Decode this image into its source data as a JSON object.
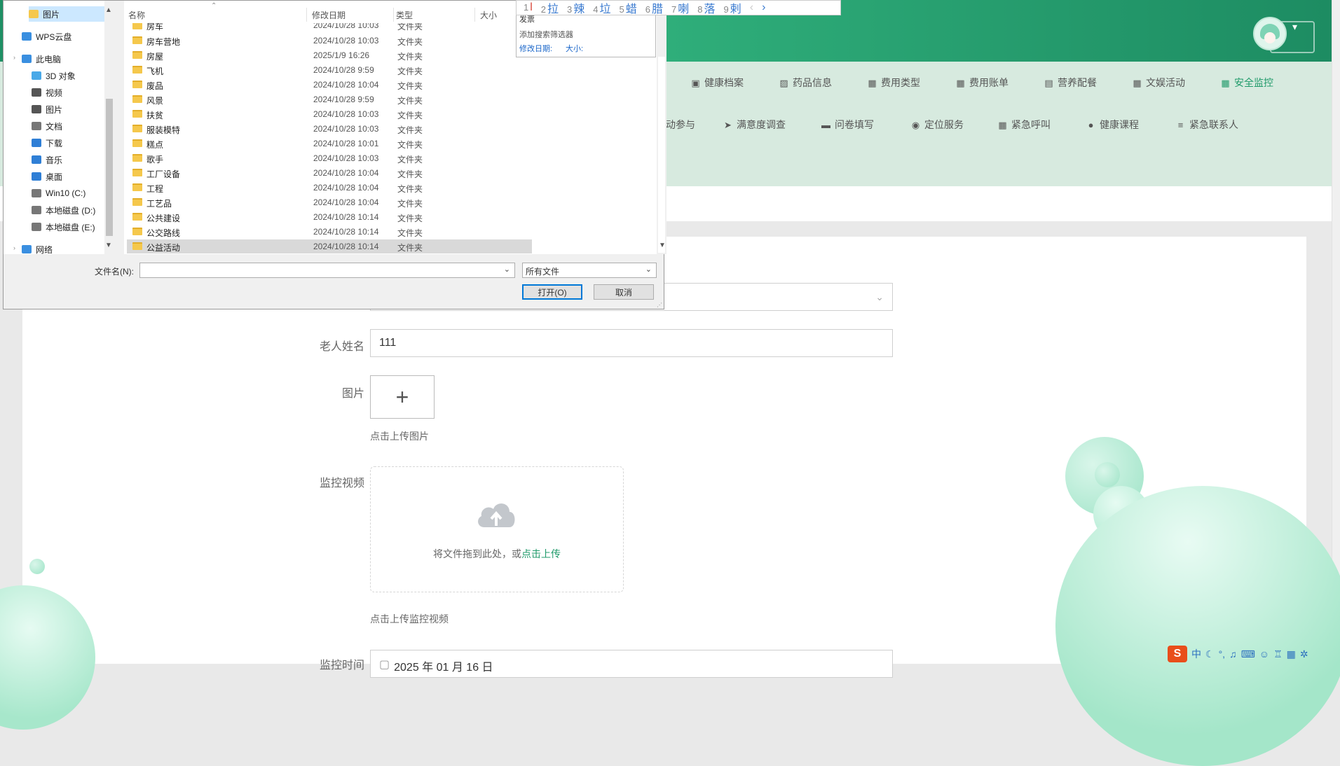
{
  "app": {
    "nav_row1": [
      {
        "icon": "briefcase-icon",
        "label": "健康档案"
      },
      {
        "icon": "chart-icon",
        "label": "药品信息"
      },
      {
        "icon": "grid-icon",
        "label": "费用类型"
      },
      {
        "icon": "grid-icon",
        "label": "费用账单"
      },
      {
        "icon": "clipboard-icon",
        "label": "营养配餐"
      },
      {
        "icon": "grid-icon",
        "label": "文娱活动"
      },
      {
        "icon": "grid-icon",
        "label": "安全监控"
      }
    ],
    "nav_row2": [
      {
        "icon": "",
        "label": "动参与"
      },
      {
        "icon": "send-icon",
        "label": "满意度调查"
      },
      {
        "icon": "monitor-icon",
        "label": "问卷填写"
      },
      {
        "icon": "user-icon",
        "label": "定位服务"
      },
      {
        "icon": "grid-icon",
        "label": "紧急呼叫"
      },
      {
        "icon": "pin-icon",
        "label": "健康课程"
      },
      {
        "icon": "menu-icon",
        "label": "紧急联系人"
      }
    ],
    "active_nav": "安全监控",
    "accent_color": "#1f9a6a"
  },
  "form": {
    "elder_name_label": "老人姓名",
    "elder_name_value": "111",
    "image_label": "图片",
    "image_upload_plus": "+",
    "image_hint": "点击上传图片",
    "video_label": "监控视频",
    "dropzone_text": "将文件拖到此处，或",
    "dropzone_link": "点击上传",
    "video_hint": "点击上传监控视频",
    "time_label": "监控时间",
    "time_value": "2025 年 01 月 16 日"
  },
  "file_dialog": {
    "nav_pane": [
      {
        "icon": "folder-icon",
        "label": "图片"
      },
      {
        "icon": "cloud-icon",
        "label": "WPS云盘"
      },
      {
        "icon": "computer-icon",
        "label": "此电脑"
      },
      {
        "icon": "cube-icon",
        "label": "3D 对象"
      },
      {
        "icon": "video-icon",
        "label": "视频"
      },
      {
        "icon": "image-icon",
        "label": "图片"
      },
      {
        "icon": "document-icon",
        "label": "文档"
      },
      {
        "icon": "download-icon",
        "label": "下载"
      },
      {
        "icon": "music-icon",
        "label": "音乐"
      },
      {
        "icon": "desktop-icon",
        "label": "桌面"
      },
      {
        "icon": "drive-icon",
        "label": "Win10 (C:)"
      },
      {
        "icon": "drive-icon",
        "label": "本地磁盘 (D:)"
      },
      {
        "icon": "drive-icon",
        "label": "本地磁盘 (E:)"
      },
      {
        "icon": "network-icon",
        "label": "网络"
      }
    ],
    "columns": {
      "name": "名称",
      "date": "修改日期",
      "type": "类型",
      "size": "大小"
    },
    "rows": [
      {
        "name": "房车",
        "date": "2024/10/28 10:03",
        "type": "文件夹"
      },
      {
        "name": "房车营地",
        "date": "2024/10/28 10:03",
        "type": "文件夹"
      },
      {
        "name": "房屋",
        "date": "2025/1/9 16:26",
        "type": "文件夹"
      },
      {
        "name": "飞机",
        "date": "2024/10/28 9:59",
        "type": "文件夹"
      },
      {
        "name": "废品",
        "date": "2024/10/28 10:04",
        "type": "文件夹"
      },
      {
        "name": "风景",
        "date": "2024/10/28 9:59",
        "type": "文件夹"
      },
      {
        "name": "扶贫",
        "date": "2024/10/28 10:03",
        "type": "文件夹"
      },
      {
        "name": "服装模特",
        "date": "2024/10/28 10:03",
        "type": "文件夹"
      },
      {
        "name": "糕点",
        "date": "2024/10/28 10:01",
        "type": "文件夹"
      },
      {
        "name": "歌手",
        "date": "2024/10/28 10:03",
        "type": "文件夹"
      },
      {
        "name": "工厂设备",
        "date": "2024/10/28 10:04",
        "type": "文件夹"
      },
      {
        "name": "工程",
        "date": "2024/10/28 10:04",
        "type": "文件夹"
      },
      {
        "name": "工艺品",
        "date": "2024/10/28 10:04",
        "type": "文件夹"
      },
      {
        "name": "公共建设",
        "date": "2024/10/28 10:14",
        "type": "文件夹"
      },
      {
        "name": "公交路线",
        "date": "2024/10/28 10:14",
        "type": "文件夹"
      },
      {
        "name": "公益活动",
        "date": "2024/10/28 10:14",
        "type": "文件夹"
      }
    ],
    "selected_row": "公益活动",
    "filename_label": "文件名(N):",
    "filename_value": "",
    "filetype_value": "所有文件",
    "open_button": "打开(O)",
    "cancel_button": "取消",
    "search_suggest": {
      "partial": "发票",
      "add_filter": "添加搜索筛选器",
      "filter_date": "修改日期:",
      "filter_size": "大小:"
    }
  },
  "ime": {
    "candidates": [
      {
        "num": "1",
        "text": "l"
      },
      {
        "num": "2",
        "text": "拉"
      },
      {
        "num": "3",
        "text": "辣"
      },
      {
        "num": "4",
        "text": "垃"
      },
      {
        "num": "5",
        "text": "蜡"
      },
      {
        "num": "6",
        "text": "腊"
      },
      {
        "num": "7",
        "text": "喇"
      },
      {
        "num": "8",
        "text": "落"
      },
      {
        "num": "9",
        "text": "剌"
      }
    ],
    "prev": "‹",
    "next": "›"
  },
  "tray": {
    "logo": "S",
    "mode": "中",
    "icons": [
      "moon-icon",
      "punctuation-icon",
      "mic-icon",
      "keyboard-icon",
      "user-icon",
      "shirt-icon",
      "grid-icon",
      "gear-icon"
    ]
  }
}
